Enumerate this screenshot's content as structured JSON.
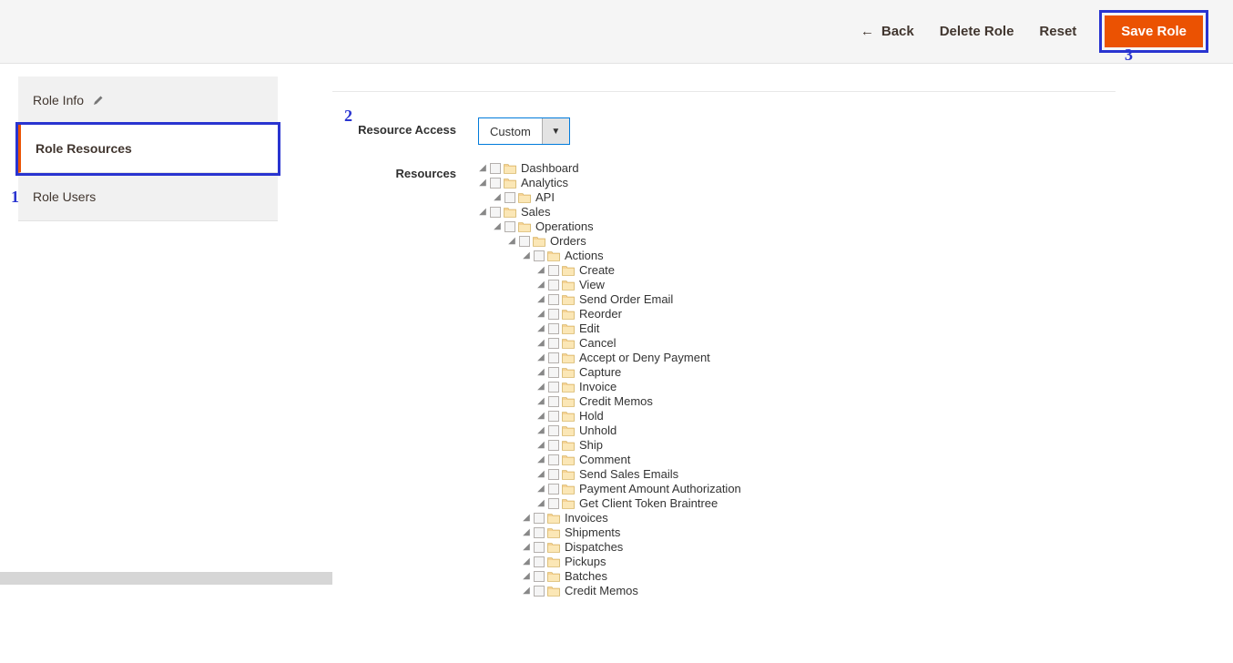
{
  "toolbar": {
    "back": "Back",
    "delete": "Delete Role",
    "reset": "Reset",
    "save": "Save Role"
  },
  "sidebar": {
    "items": [
      {
        "label": "Role Info",
        "editable": true
      },
      {
        "label": "Role Resources"
      },
      {
        "label": "Role Users"
      }
    ]
  },
  "form": {
    "resource_access_label": "Resource Access",
    "resource_access_value": "Custom",
    "resources_label": "Resources"
  },
  "annotations": {
    "a1": "1",
    "a2": "2",
    "a3": "3"
  },
  "tree": [
    {
      "label": "Dashboard",
      "children": []
    },
    {
      "label": "Analytics",
      "children": [
        {
          "label": "API",
          "children": []
        }
      ]
    },
    {
      "label": "Sales",
      "children": [
        {
          "label": "Operations",
          "children": [
            {
              "label": "Orders",
              "children": [
                {
                  "label": "Actions",
                  "children": [
                    {
                      "label": "Create",
                      "children": []
                    },
                    {
                      "label": "View",
                      "children": []
                    },
                    {
                      "label": "Send Order Email",
                      "children": []
                    },
                    {
                      "label": "Reorder",
                      "children": []
                    },
                    {
                      "label": "Edit",
                      "children": []
                    },
                    {
                      "label": "Cancel",
                      "children": []
                    },
                    {
                      "label": "Accept or Deny Payment",
                      "children": []
                    },
                    {
                      "label": "Capture",
                      "children": []
                    },
                    {
                      "label": "Invoice",
                      "children": []
                    },
                    {
                      "label": "Credit Memos",
                      "children": []
                    },
                    {
                      "label": "Hold",
                      "children": []
                    },
                    {
                      "label": "Unhold",
                      "children": []
                    },
                    {
                      "label": "Ship",
                      "children": []
                    },
                    {
                      "label": "Comment",
                      "children": []
                    },
                    {
                      "label": "Send Sales Emails",
                      "children": []
                    },
                    {
                      "label": "Payment Amount Authorization",
                      "children": []
                    },
                    {
                      "label": "Get Client Token Braintree",
                      "children": []
                    }
                  ]
                },
                {
                  "label": "Invoices",
                  "children": []
                },
                {
                  "label": "Shipments",
                  "children": []
                },
                {
                  "label": "Dispatches",
                  "children": []
                },
                {
                  "label": "Pickups",
                  "children": []
                },
                {
                  "label": "Batches",
                  "children": []
                },
                {
                  "label": "Credit Memos",
                  "children": []
                }
              ]
            }
          ]
        }
      ]
    }
  ]
}
